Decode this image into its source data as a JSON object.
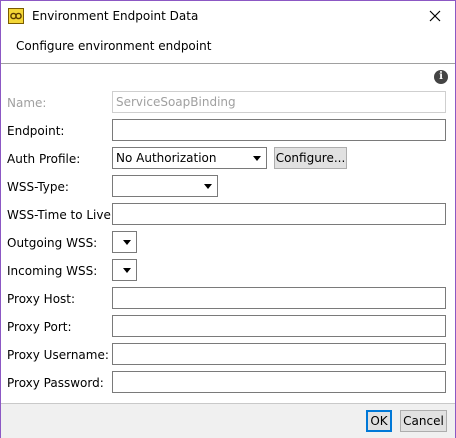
{
  "window": {
    "title": "Environment Endpoint Data"
  },
  "header": {
    "text": "Configure environment endpoint"
  },
  "form": {
    "name": {
      "label": "Name:",
      "value": "ServiceSoapBinding"
    },
    "endpoint": {
      "label": "Endpoint:",
      "value": ""
    },
    "auth_profile": {
      "label": "Auth Profile:",
      "value": "No Authorization",
      "configure_label": "Configure..."
    },
    "wss_type": {
      "label": "WSS-Type:",
      "value": ""
    },
    "wss_ttl": {
      "label": "WSS-Time to Live:",
      "value": ""
    },
    "outgoing_wss": {
      "label": "Outgoing WSS:",
      "value": ""
    },
    "incoming_wss": {
      "label": "Incoming WSS:",
      "value": ""
    },
    "proxy_host": {
      "label": "Proxy Host:",
      "value": ""
    },
    "proxy_port": {
      "label": "Proxy Port:",
      "value": ""
    },
    "proxy_username": {
      "label": "Proxy Username:",
      "value": ""
    },
    "proxy_password": {
      "label": "Proxy Password:",
      "value": ""
    }
  },
  "buttons": {
    "ok": "OK",
    "cancel": "Cancel"
  },
  "icons": {
    "app": "app-icon",
    "close": "close-icon",
    "info": "info-icon",
    "dropdown": "chevron-down-icon"
  },
  "colors": {
    "window_border": "#8c58c4",
    "default_button_border": "#0078d7",
    "disabled_text": "#a0a0a0"
  }
}
